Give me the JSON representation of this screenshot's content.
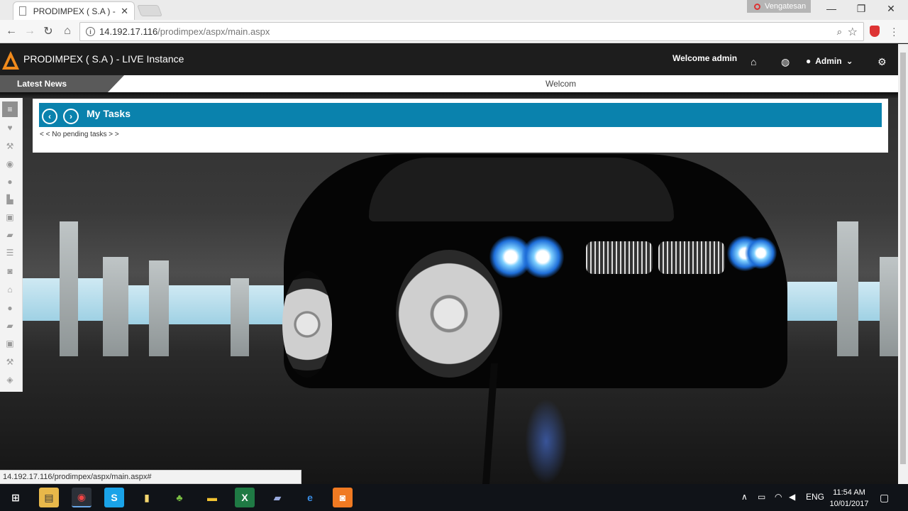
{
  "browser": {
    "tab_title": "PRODIMPEX ( S.A ) - LIVE",
    "tab_close": "✕",
    "profile_name": "Vengatesan",
    "url_host": "14.192.17.116",
    "url_path": "/prodimpex/aspx/main.aspx",
    "status_url": "14.192.17.116/prodimpex/aspx/main.aspx#"
  },
  "app": {
    "title": "PRODIMPEX ( S.A ) - LIVE Instance",
    "welcome": "Welcome admin",
    "user_menu_label": "Admin",
    "brand_color": "#f08a1c"
  },
  "news": {
    "label": "Latest News",
    "ticker": "Welcom"
  },
  "tasks": {
    "title": "My Tasks",
    "empty_message": "< < No pending tasks > >",
    "header_color": "#0a82ad"
  },
  "sidebar_icons": [
    "list-icon",
    "heart-icon",
    "wrench-icon",
    "eye-icon",
    "user-icon",
    "cart-icon",
    "briefcase-icon",
    "folder-icon",
    "list-alt-icon",
    "camera-icon",
    "home-icon",
    "user-icon",
    "folder-icon",
    "briefcase-icon",
    "wrench-icon",
    "map-marker-icon"
  ],
  "taskbar": {
    "language": "ENG",
    "time": "11:54 AM",
    "date": "10/01/2017"
  }
}
